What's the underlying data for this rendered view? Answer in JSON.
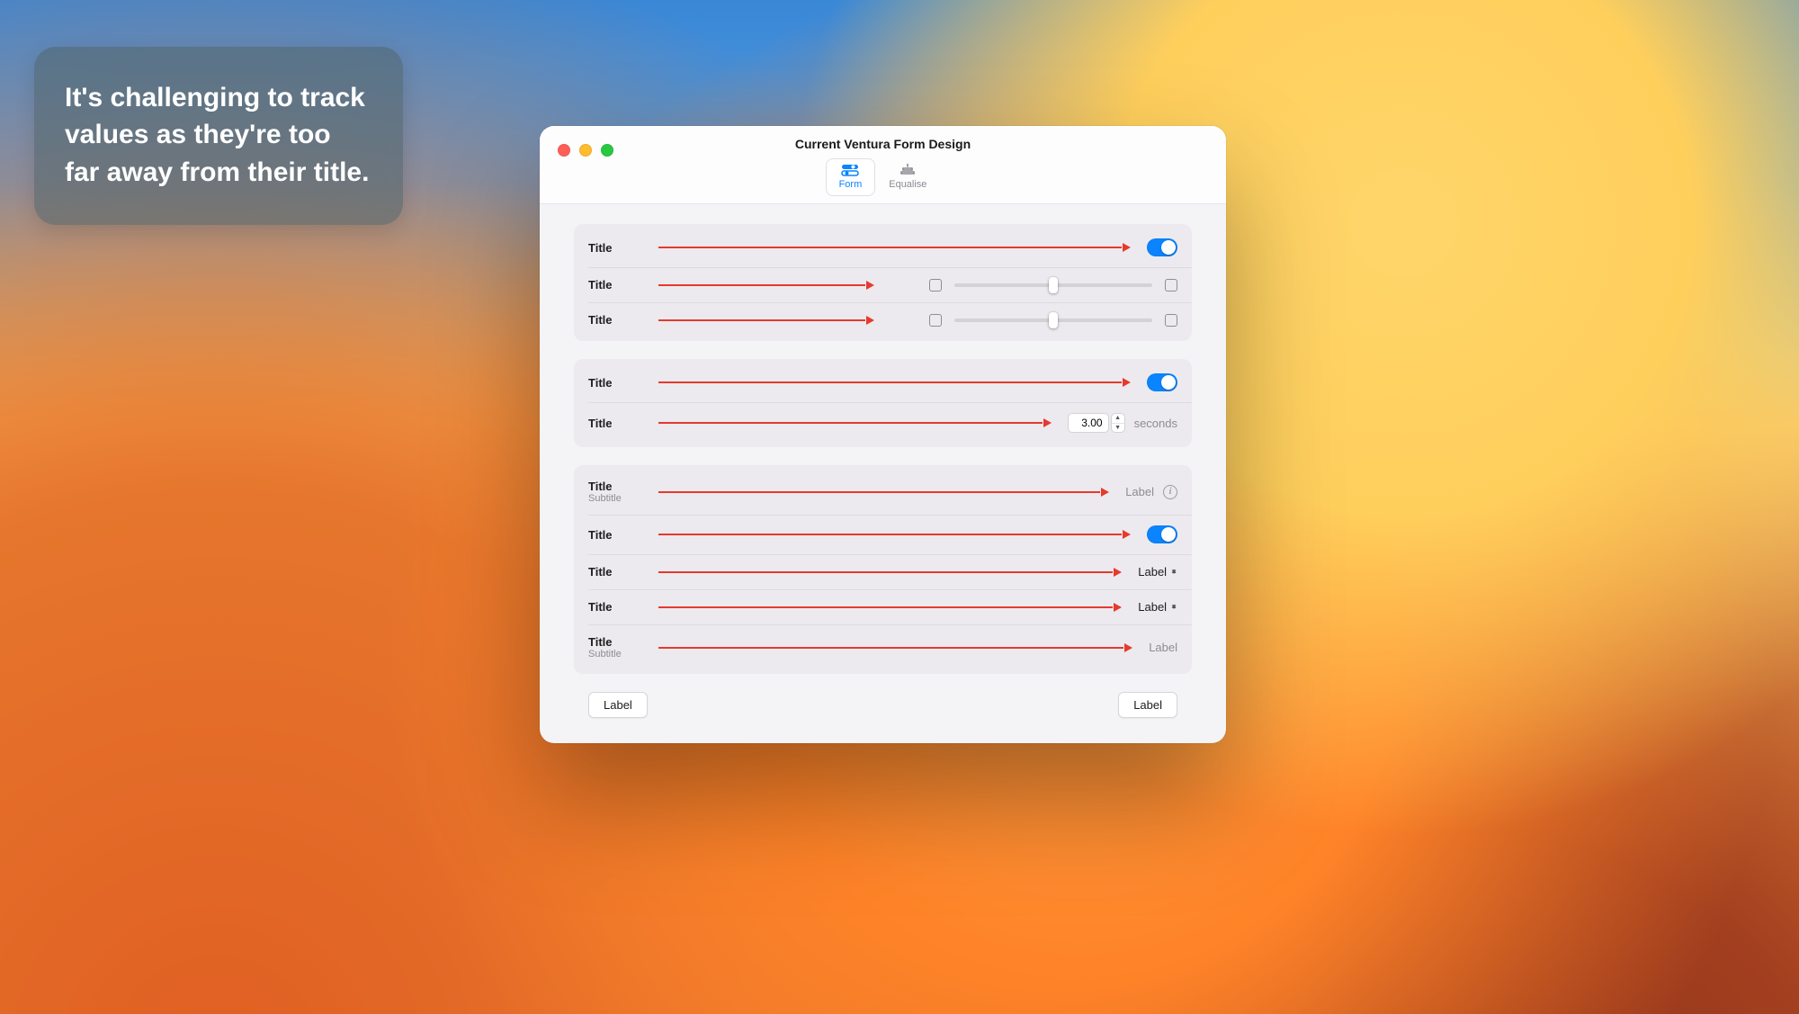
{
  "callout": {
    "text": "It's challenging to track values as they're too far away from their title."
  },
  "window": {
    "title": "Current Ventura Form Design",
    "tabs": {
      "form": "Form",
      "equalise": "Equalise"
    }
  },
  "group1": {
    "row1": {
      "title": "Title"
    },
    "row2": {
      "title": "Title"
    },
    "row3": {
      "title": "Title"
    }
  },
  "group2": {
    "row1": {
      "title": "Title"
    },
    "row2": {
      "title": "Title",
      "value": "3.00",
      "unit": "seconds"
    }
  },
  "group3": {
    "row1": {
      "title": "Title",
      "subtitle": "Subtitle",
      "value": "Label"
    },
    "row2": {
      "title": "Title"
    },
    "row3": {
      "title": "Title",
      "value": "Label"
    },
    "row4": {
      "title": "Title",
      "value": "Label"
    },
    "row5": {
      "title": "Title",
      "subtitle": "Subtitle",
      "value": "Label"
    }
  },
  "footer": {
    "left": "Label",
    "right": "Label"
  }
}
